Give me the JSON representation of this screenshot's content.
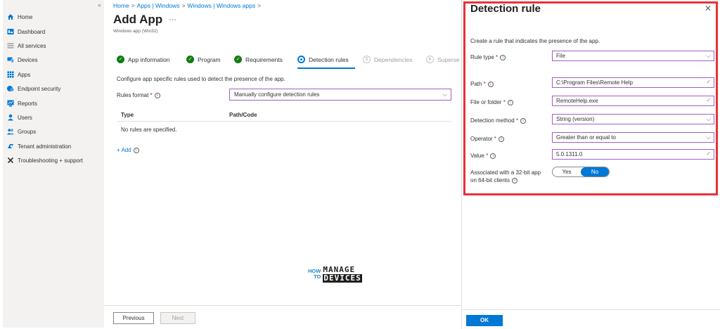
{
  "sidebar": {
    "collapse": "«",
    "items": [
      {
        "label": "Home",
        "icon": "home-icon",
        "color": "#0078d4"
      },
      {
        "label": "Dashboard",
        "icon": "dashboard-icon",
        "color": "#0078d4"
      },
      {
        "label": "All services",
        "icon": "list-icon",
        "color": "#8a8886"
      },
      {
        "label": "Devices",
        "icon": "devices-icon",
        "color": "#0078d4"
      },
      {
        "label": "Apps",
        "icon": "apps-icon",
        "color": "#0078d4"
      },
      {
        "label": "Endpoint security",
        "icon": "shield-icon",
        "color": "#0078d4"
      },
      {
        "label": "Reports",
        "icon": "reports-icon",
        "color": "#0078d4"
      },
      {
        "label": "Users",
        "icon": "user-icon",
        "color": "#0078d4"
      },
      {
        "label": "Groups",
        "icon": "groups-icon",
        "color": "#0078d4"
      },
      {
        "label": "Tenant administration",
        "icon": "tenant-icon",
        "color": "#0078d4"
      },
      {
        "label": "Troubleshooting + support",
        "icon": "wrench-icon",
        "color": "#323130"
      }
    ]
  },
  "main": {
    "breadcrumb": [
      "Home",
      "Apps | Windows",
      "Windows | Windows apps"
    ],
    "breadcrumb_sep": ">",
    "title": "Add App",
    "title_more": "···",
    "subtitle": "Windows app (Win32)",
    "steps": [
      {
        "label": "App information",
        "state": "done"
      },
      {
        "label": "Program",
        "state": "done"
      },
      {
        "label": "Requirements",
        "state": "done"
      },
      {
        "label": "Detection rules",
        "state": "active"
      },
      {
        "label": "Dependencies",
        "state": "pending",
        "num": "5"
      },
      {
        "label": "Superse",
        "state": "pending",
        "num": "6"
      }
    ],
    "description": "Configure app specific rules used to detect the presence of the app.",
    "rules_format_label": "Rules format",
    "rules_format_value": "Manually configure detection rules",
    "table_headers": [
      "Type",
      "Path/Code"
    ],
    "empty_text": "No rules are specified.",
    "add_label": "+ Add",
    "logo_how": "HOW",
    "logo_to": "TO",
    "logo_manage": "MANAGE",
    "logo_devices": "DEVICES",
    "prev_label": "Previous",
    "next_label": "Next"
  },
  "panel": {
    "title": "Detection rule",
    "close": "✕",
    "description": "Create a rule that indicates the presence of the app.",
    "fields": {
      "rule_type": {
        "label": "Rule type",
        "value": "File"
      },
      "path": {
        "label": "Path",
        "value": "C:\\Program Files\\Remote Help"
      },
      "file_or_folder": {
        "label": "File or folder",
        "value": "RemoteHelp.exe"
      },
      "detection_method": {
        "label": "Detection method",
        "value": "String (version)"
      },
      "operator": {
        "label": "Operator",
        "value": "Greater than or equal to"
      },
      "value": {
        "label": "Value",
        "value": "5.0.1311.0"
      }
    },
    "assoc_line1": "Associated with a 32-bit app",
    "assoc_line2": "on 64-bit clients",
    "toggle_yes": "Yes",
    "toggle_no": "No",
    "ok_label": "OK"
  }
}
